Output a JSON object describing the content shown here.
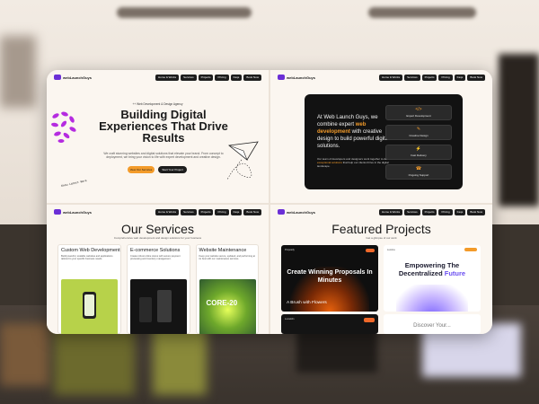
{
  "nav": {
    "brand": "webLaunchGuys",
    "links": [
      "Home & Works",
      "Services",
      "Projects",
      "Pricing",
      "Faqs",
      "Book Now"
    ]
  },
  "hero": {
    "tagline": "++ Web Development & Design Agency",
    "title": "Building Digital Experiences That Drive Results",
    "description": "We craft stunning websites and digital solutions that elevate your brand. From concept to deployment, we bring your vision to life with expert development and creative design.",
    "primary_button": "View Our Services",
    "secondary_button": "Start Your Project",
    "handwritten_note": "Know Latest Work"
  },
  "about": {
    "lead_prefix": "At Web Launch Guys, we combine expert ",
    "lead_highlight": "web development",
    "lead_suffix": " with creative design to build powerful digital solutions.",
    "sub_prefix": "Our team of developers and designers work together to deliver ",
    "sub_highlight": "exceptional solutions",
    "sub_suffix": " that help our clients thrive in the digital landscape.",
    "services": [
      {
        "icon": "code-icon",
        "label": "Expert Development"
      },
      {
        "icon": "palette-icon",
        "label": "Creative Design"
      },
      {
        "icon": "bolt-icon",
        "label": "Fast Delivery"
      },
      {
        "icon": "support-icon",
        "label": "Ongoing Support"
      }
    ]
  },
  "services_section": {
    "title": "Our Services",
    "subtitle": "Comprehensive web development and design solutions for your business",
    "cards": [
      {
        "title": "Custom Web Development",
        "description": "Build powerful, scalable websites and applications tailored to your specific business needs."
      },
      {
        "title": "E-commerce Solutions",
        "description": "Create robust online stores with secure payment processing and inventory management."
      },
      {
        "title": "Website Maintenance",
        "description": "Keep your website secure, updated, and performing at its best with our maintenance services.",
        "image_text": "CORE-20"
      }
    ]
  },
  "projects_section": {
    "title": "Featured Projects",
    "subtitle": "Get a glimpse of our work",
    "project_1": {
      "title": "Create Winning Proposals In Minutes",
      "caption": "A Brush with Flowers",
      "brand": "Proposify"
    },
    "project_2": {
      "title_prefix": "Empowering The Decentralized ",
      "title_highlight": "Future",
      "brand": "Lumina"
    },
    "project_3": {
      "brand": "Lumeklin"
    },
    "project_4": {
      "title": "Discover Your..."
    }
  },
  "colors": {
    "accent_orange": "#f39b2a",
    "brand_purple": "#6b2fd6",
    "dark": "#121212",
    "cream": "#fbf6f0"
  }
}
